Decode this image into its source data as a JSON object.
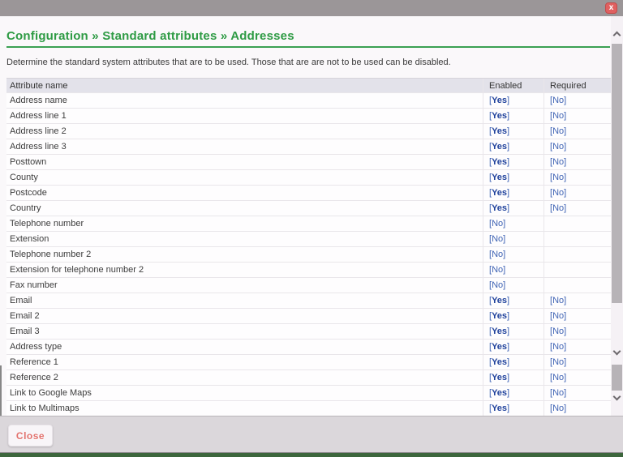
{
  "window": {
    "close_icon": "x"
  },
  "header": {
    "breadcrumb": "Configuration » Standard attributes » Addresses",
    "description": "Determine the standard system attributes that are to be used. Those that are are not to be used can be disabled."
  },
  "table": {
    "columns": [
      "Attribute name",
      "Enabled",
      "Required"
    ],
    "rows": [
      {
        "name": "Address name",
        "enabled": "Yes",
        "required": "No"
      },
      {
        "name": "Address line 1",
        "enabled": "Yes",
        "required": "No"
      },
      {
        "name": "Address line 2",
        "enabled": "Yes",
        "required": "No"
      },
      {
        "name": "Address line 3",
        "enabled": "Yes",
        "required": "No"
      },
      {
        "name": "Posttown",
        "enabled": "Yes",
        "required": "No"
      },
      {
        "name": "County",
        "enabled": "Yes",
        "required": "No"
      },
      {
        "name": "Postcode",
        "enabled": "Yes",
        "required": "No"
      },
      {
        "name": "Country",
        "enabled": "Yes",
        "required": "No"
      },
      {
        "name": "Telephone number",
        "enabled": "No",
        "required": ""
      },
      {
        "name": "Extension",
        "enabled": "No",
        "required": ""
      },
      {
        "name": "Telephone number 2",
        "enabled": "No",
        "required": ""
      },
      {
        "name": "Extension for telephone number 2",
        "enabled": "No",
        "required": ""
      },
      {
        "name": "Fax number",
        "enabled": "No",
        "required": ""
      },
      {
        "name": "Email",
        "enabled": "Yes",
        "required": "No"
      },
      {
        "name": "Email 2",
        "enabled": "Yes",
        "required": "No"
      },
      {
        "name": "Email 3",
        "enabled": "Yes",
        "required": "No"
      },
      {
        "name": "Address type",
        "enabled": "Yes",
        "required": "No"
      },
      {
        "name": "Reference 1",
        "enabled": "Yes",
        "required": "No"
      },
      {
        "name": "Reference 2",
        "enabled": "Yes",
        "required": "No"
      },
      {
        "name": "Link to Google Maps",
        "enabled": "Yes",
        "required": "No"
      },
      {
        "name": "Link to Multimaps",
        "enabled": "Yes",
        "required": "No"
      }
    ]
  },
  "footer": {
    "close_label": "Close"
  },
  "colors": {
    "heading_green": "#2e9b44",
    "link_blue": "#3f63b4",
    "link_blue_bold": "#20429c",
    "titlebar_gray": "#9b9698",
    "close_red": "#e06060",
    "header_row_bg": "#e3e2ea",
    "footer_gray": "#dbd7db",
    "bottom_bar_green": "#3c663c"
  }
}
